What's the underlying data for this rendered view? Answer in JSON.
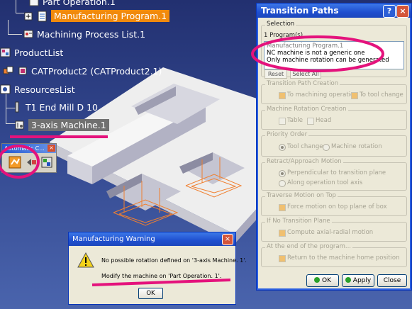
{
  "spec_tree": {
    "part_operation": "Part Operation.1",
    "manufacturing_program": "Manufacturing Program.1",
    "machining_process_list": "Machining Process List.1",
    "product_list": "ProductList",
    "cat_product": "CATProduct2 (CATProduct2.1)",
    "resources_list": "ResourcesList",
    "tool": "T1 End Mill D 10",
    "machine": "3-axis Machine.1"
  },
  "toolbar": {
    "title": "Automatic C...",
    "close": "×"
  },
  "transition_paths": {
    "title": "Transition Paths",
    "help": "?",
    "close": "×",
    "selection": {
      "label": "Selection",
      "count": "1 Program(s)",
      "list": [
        "Manufacturing Program.1",
        "NC machine is not a generic one",
        "Only machine rotation can be generated"
      ],
      "reset": "Reset",
      "select_all": "Select All"
    },
    "path_creation": {
      "label": "Transition Path Creation",
      "to_machining": "To machining operation",
      "to_tool_change": "To tool change"
    },
    "rotation_creation": {
      "label": "Machine Rotation Creation",
      "table": "Table",
      "head": "Head"
    },
    "priority_order": {
      "label": "Priority Order",
      "tool_change": "Tool change",
      "machine_rotation": "Machine rotation"
    },
    "retract": {
      "label": "Retract/Approach Motion",
      "perpendicular": "Perpendicular to transition plane",
      "along_axis": "Along operation tool axis"
    },
    "traverse": {
      "label": "Traverse Motion on Top",
      "force": "Force motion on top plane of box"
    },
    "no_plane": {
      "label": "If No Transition Plane",
      "compute": "Compute axial-radial motion"
    },
    "end_program": {
      "label": "At the end of the program...",
      "return": "Return to the machine home position"
    },
    "ok": "OK",
    "apply": "Apply",
    "cancel": "Close"
  },
  "warning": {
    "title": "Manufacturing Warning",
    "close": "×",
    "line1": "No possible rotation defined on '3-axis Machine. 1'.",
    "line2": "Modify the machine on 'Part Operation. 1'.",
    "ok": "OK"
  },
  "colors": {
    "highlight": "#f18a0c",
    "annotation": "#e4127c",
    "dialog_bg": "#ece9d8",
    "titlebar": "#1f4fcf"
  }
}
